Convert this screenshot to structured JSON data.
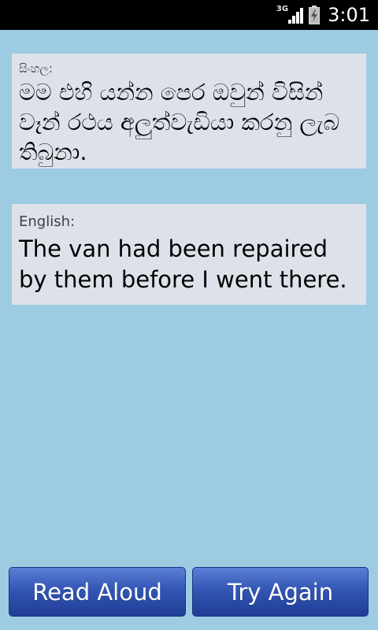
{
  "status_bar": {
    "network_type": "3G",
    "time": "3:01",
    "icons": [
      "signal-icon",
      "battery-icon"
    ]
  },
  "sinhala_panel": {
    "label": "සිංහල:",
    "text": "මම එහි යන්න පෙර ඔවුන් විසින් වෑන් රථය අලුත්වැඩියා කරනු ලැබ තිබුනා."
  },
  "english_panel": {
    "label": "English:",
    "text": "The van had been repaired by them before I went there."
  },
  "buttons": {
    "read_aloud": "Read Aloud",
    "try_again": "Try Again"
  },
  "colors": {
    "background": "#9dcbe1",
    "panel": "#dde2ea",
    "button": "#3456b4",
    "status_bar": "#000000"
  }
}
